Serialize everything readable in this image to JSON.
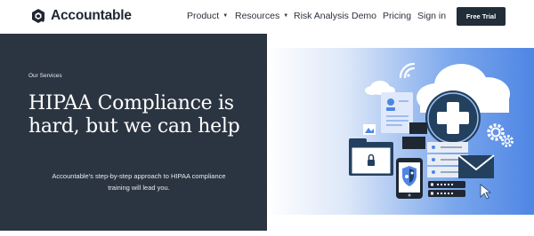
{
  "header": {
    "brand": "Accountable",
    "nav": [
      {
        "label": "Product",
        "has_dropdown": true
      },
      {
        "label": "Resources",
        "has_dropdown": true
      },
      {
        "label": "Risk Analysis",
        "has_dropdown": false
      },
      {
        "label": "Demo",
        "has_dropdown": false
      },
      {
        "label": "Pricing",
        "has_dropdown": false
      },
      {
        "label": "Sign in",
        "has_dropdown": false
      }
    ],
    "cta_label": "Free Trial",
    "caret": "▼"
  },
  "hero": {
    "eyebrow": "Our Services",
    "headline_line1": "HIPAA Compliance is",
    "headline_line2": "hard, but we can help",
    "description_line1": "Accountable's step-by-step approach to HIPAA compliance",
    "description_line2": "training will lead you.",
    "illustration_icons": [
      "cloud-icon",
      "medical-cross-icon",
      "wifi-icon",
      "id-card-icon",
      "folder-icon",
      "lock-icon",
      "shield-icon",
      "phone-icon",
      "envelope-icon",
      "gear-icon",
      "server-icon",
      "password-field-icon",
      "cursor-icon"
    ]
  },
  "colors": {
    "dark_panel": "#2b3541",
    "cta_bg": "#222d3a",
    "accent_blue": "#4f86e4",
    "navy": "#23405f"
  }
}
